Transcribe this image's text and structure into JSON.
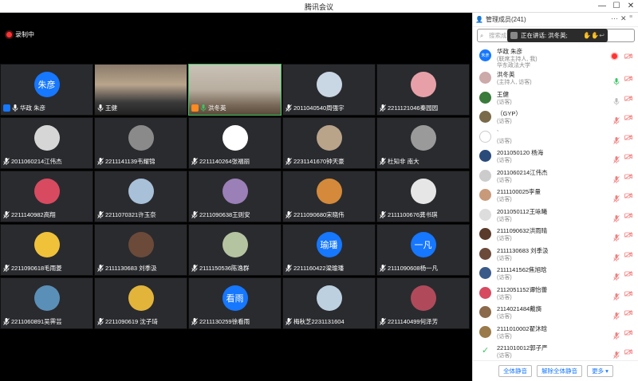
{
  "window": {
    "title": "腾讯会议",
    "minimize": "—",
    "maximize": "☐",
    "close": "✕"
  },
  "recording": {
    "label": "录制中"
  },
  "tiles": [
    {
      "name": "华政 朱彦",
      "avatar_text": "朱彦",
      "avatar_color": "#1677ff",
      "badge": "host"
    },
    {
      "name": "王健",
      "video": true,
      "badge": "none"
    },
    {
      "name": "洪冬英",
      "video": true,
      "badge": "cohost",
      "speaking": true
    },
    {
      "name": "2011040540周强宇",
      "avatar_color": "#c9d6e3"
    },
    {
      "name": "2211121046秦园园",
      "avatar_color": "#e8a0a8"
    },
    {
      "name": "2011060214江伟杰",
      "avatar_color": "#d6d6d6"
    },
    {
      "name": "2211141139韦耀锦",
      "avatar_color": "#8a8a8a"
    },
    {
      "name": "2211140264张福丽",
      "avatar_color": "#ffffff"
    },
    {
      "name": "2231141670钟天豪",
      "avatar_color": "#b9a48a"
    },
    {
      "name": "杜知非 南大",
      "avatar_color": "#9a9a9a"
    },
    {
      "name": "2211140982高翔",
      "avatar_color": "#d84a60"
    },
    {
      "name": "2211070321许玉奈",
      "avatar_color": "#a8c0d8"
    },
    {
      "name": "2211090638王则安",
      "avatar_color": "#9b7fb7"
    },
    {
      "name": "2211090680宋晓伟",
      "avatar_color": "#d48a3a"
    },
    {
      "name": "2111100676龚书琪",
      "avatar_color": "#e6e6e6"
    },
    {
      "name": "2211090618毛雨菱",
      "avatar_color": "#f0c23a"
    },
    {
      "name": "2111130683 刘季汲",
      "avatar_color": "#6b4a3a"
    },
    {
      "name": "2111150536陈逸群",
      "avatar_color": "#b5c4a0"
    },
    {
      "name": "2211160422梁瑜璠",
      "avatar_text": "瑜璠",
      "avatar_color": "#1677ff"
    },
    {
      "name": "2111090608杨一凡",
      "avatar_text": "一凡",
      "avatar_color": "#1677ff"
    },
    {
      "name": "2211060891吴霁芸",
      "avatar_color": "#5a8fb7"
    },
    {
      "name": "2211090619 沈子琦",
      "avatar_color": "#e2b43a"
    },
    {
      "name": "2211130259徐看雨",
      "avatar_text": "看雨",
      "avatar_color": "#1677ff"
    },
    {
      "name": "梅秋芝2231131604",
      "avatar_color": "#bcd0e0"
    },
    {
      "name": "2211140499何泽芳",
      "avatar_color": "#b04a5a"
    }
  ],
  "panel": {
    "title": "管理成员(241)",
    "more_icon": "···",
    "close_icon": "✕",
    "search_placeholder": "搜索成",
    "now_speaking": "正在讲话: 洪冬英;",
    "members": [
      {
        "name": "华政 朱彦",
        "role": "(联席主持人, 我)",
        "role2": "华东政法大学",
        "avatar_text": "朱彦",
        "avatar_color": "#1677ff",
        "mic": "recording"
      },
      {
        "name": "洪冬英",
        "role": "(主持人, 访客)",
        "avatar_color": "#caa",
        "mic": "on"
      },
      {
        "name": "王健",
        "role": "(访客)",
        "avatar_color": "#3a7a3a",
        "mic": "grey"
      },
      {
        "name": "（GYP）",
        "role": "(访客)",
        "avatar_color": "#7a6a4a",
        "mic": "muted"
      },
      {
        "name": "`",
        "role": "(访客)",
        "avatar_color": "#ffffff",
        "mic": "muted"
      },
      {
        "name": "2011050120 杨海",
        "role": "(访客)",
        "avatar_color": "#2a4a7a",
        "mic": "muted"
      },
      {
        "name": "2011060214江伟杰",
        "role": "(访客)",
        "avatar_color": "#ccc",
        "mic": "muted"
      },
      {
        "name": "2111100025李量",
        "role": "(访客)",
        "avatar_color": "#c89a7a",
        "mic": "muted"
      },
      {
        "name": "2011050112王咏曦",
        "role": "(访客)",
        "avatar_color": "#ddd",
        "mic": "muted"
      },
      {
        "name": "2111090632洪雨晴",
        "role": "(访客)",
        "avatar_color": "#5a3a2a",
        "mic": "muted"
      },
      {
        "name": "2111130683 刘季汲",
        "role": "(访客)",
        "avatar_color": "#6b4a3a",
        "mic": "muted"
      },
      {
        "name": "2111141562焦旭晗",
        "role": "(访客)",
        "avatar_color": "#3a5a8a",
        "mic": "muted"
      },
      {
        "name": "2112051152谭怡蕾",
        "role": "(访客)",
        "avatar_color": "#d84a60",
        "mic": "muted"
      },
      {
        "name": "2114021484戴旖",
        "role": "(访客)",
        "avatar_color": "#8a6a4a",
        "mic": "muted"
      },
      {
        "name": "2111010002翟沐晗",
        "role": "(访客)",
        "avatar_color": "#9a7a4a",
        "mic": "muted"
      },
      {
        "name": "2211010012郭子严",
        "role": "(访客)",
        "avatar_color": "#ffffff",
        "mic": "muted",
        "check": true
      }
    ],
    "footer": {
      "mute_all": "全体静音",
      "unmute_all": "解除全体静音",
      "more": "更多 ▾"
    }
  }
}
